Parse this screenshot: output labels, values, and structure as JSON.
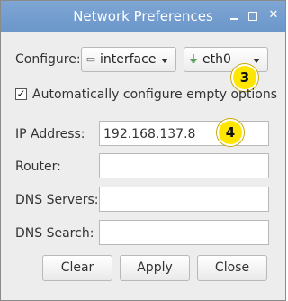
{
  "window": {
    "title": "Network Preferences"
  },
  "configure": {
    "label": "Configure:",
    "type_value": "interface",
    "type_icon": "network-interface-icon",
    "interface_value": "eth0",
    "interface_icon": "ethernet-icon"
  },
  "auto_config": {
    "label": "Automatically configure empty options",
    "checked": true
  },
  "fields": {
    "ip_address": {
      "label": "IP Address:",
      "value": "192.168.137.8"
    },
    "router": {
      "label": "Router:",
      "value": ""
    },
    "dns_servers": {
      "label": "DNS Servers:",
      "value": ""
    },
    "dns_search": {
      "label": "DNS Search:",
      "value": ""
    }
  },
  "buttons": {
    "clear": "Clear",
    "apply": "Apply",
    "close": "Close"
  },
  "annotations": {
    "badge_3": "3",
    "badge_4": "4"
  },
  "colors": {
    "titlebar": "#7aa3d3",
    "badge": "#ffe600"
  }
}
